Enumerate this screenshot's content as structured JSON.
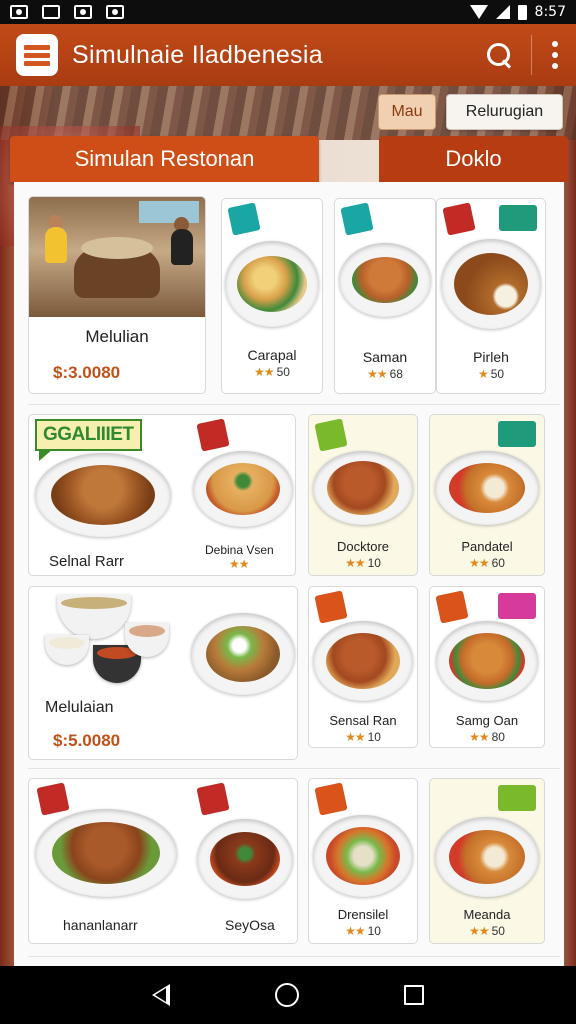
{
  "status_bar": {
    "time": "8:57"
  },
  "app_bar": {
    "title": "Simulnaie Iladbenesia"
  },
  "chips": {
    "mau": "Mau",
    "relugtgian": "Relurugian"
  },
  "tabs": {
    "simulan": "Simulan Restonan",
    "doklo": "Doklo"
  },
  "row1": {
    "restaurant": {
      "name": "Melulian",
      "price": "$:3.0080"
    },
    "items": [
      {
        "name": "Carapal",
        "rating": "50"
      },
      {
        "name": "Saman",
        "rating": "68"
      },
      {
        "name": "Pirleh",
        "rating": "50"
      }
    ]
  },
  "row2": {
    "gourmet_label": "GGALIIIET",
    "items": [
      {
        "name": "Selnal Rarr"
      },
      {
        "name": "Debina Vsen",
        "rating": ""
      },
      {
        "name": "Docktore",
        "rating": "10"
      },
      {
        "name": "Pandatel",
        "rating": "60"
      }
    ]
  },
  "row3": {
    "left": {
      "name": "Melulaian",
      "price": "$:5.0080"
    },
    "items": [
      {
        "name": "Sensal Ran",
        "rating": "10"
      },
      {
        "name": "Samg Oan",
        "rating": "80"
      }
    ]
  },
  "row4": {
    "items": [
      {
        "name": "hananlanarr"
      },
      {
        "name": "SeyOsa"
      },
      {
        "name": "Drensilel",
        "rating": "10"
      },
      {
        "name": "Meanda",
        "rating": "50"
      }
    ]
  },
  "icons": {
    "search": "search-icon",
    "more": "more-vert-icon",
    "back": "back-icon",
    "home": "home-icon",
    "recents": "recents-icon"
  },
  "colors": {
    "app_bar": "#b8421a",
    "tab_active": "#cf4e17",
    "price": "#c0521b",
    "star": "#e08a1e"
  }
}
